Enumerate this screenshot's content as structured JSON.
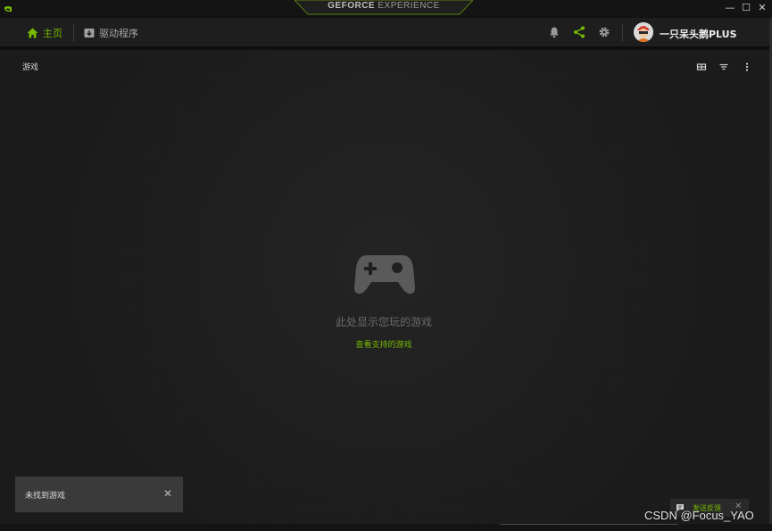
{
  "titlebar": {
    "brand_bold": "GEFORCE",
    "brand_light": "EXPERIENCE",
    "minimize": "—",
    "maximize": "☐",
    "close": "✕"
  },
  "nav": {
    "home_label": "主页",
    "drivers_label": "驱动程序",
    "username": "一只呆头鹅PLUS",
    "accent": "#76b900"
  },
  "main": {
    "section_title": "游戏",
    "empty_message": "此处显示您玩的游戏",
    "supported_games_link": "查看支持的游戏"
  },
  "toast": {
    "message": "未找到游戏",
    "close": "✕"
  },
  "feedback": {
    "label": "发送反馈",
    "close": "✕"
  },
  "watermark": "CSDN @Focus_YAO",
  "icons": [
    "nvidia-logo-icon",
    "home-icon",
    "drivers-icon",
    "bell-icon",
    "share-icon",
    "gear-icon",
    "grid-view-icon",
    "filter-icon",
    "more-icon",
    "gamepad-icon",
    "feedback-icon",
    "close-icon"
  ]
}
